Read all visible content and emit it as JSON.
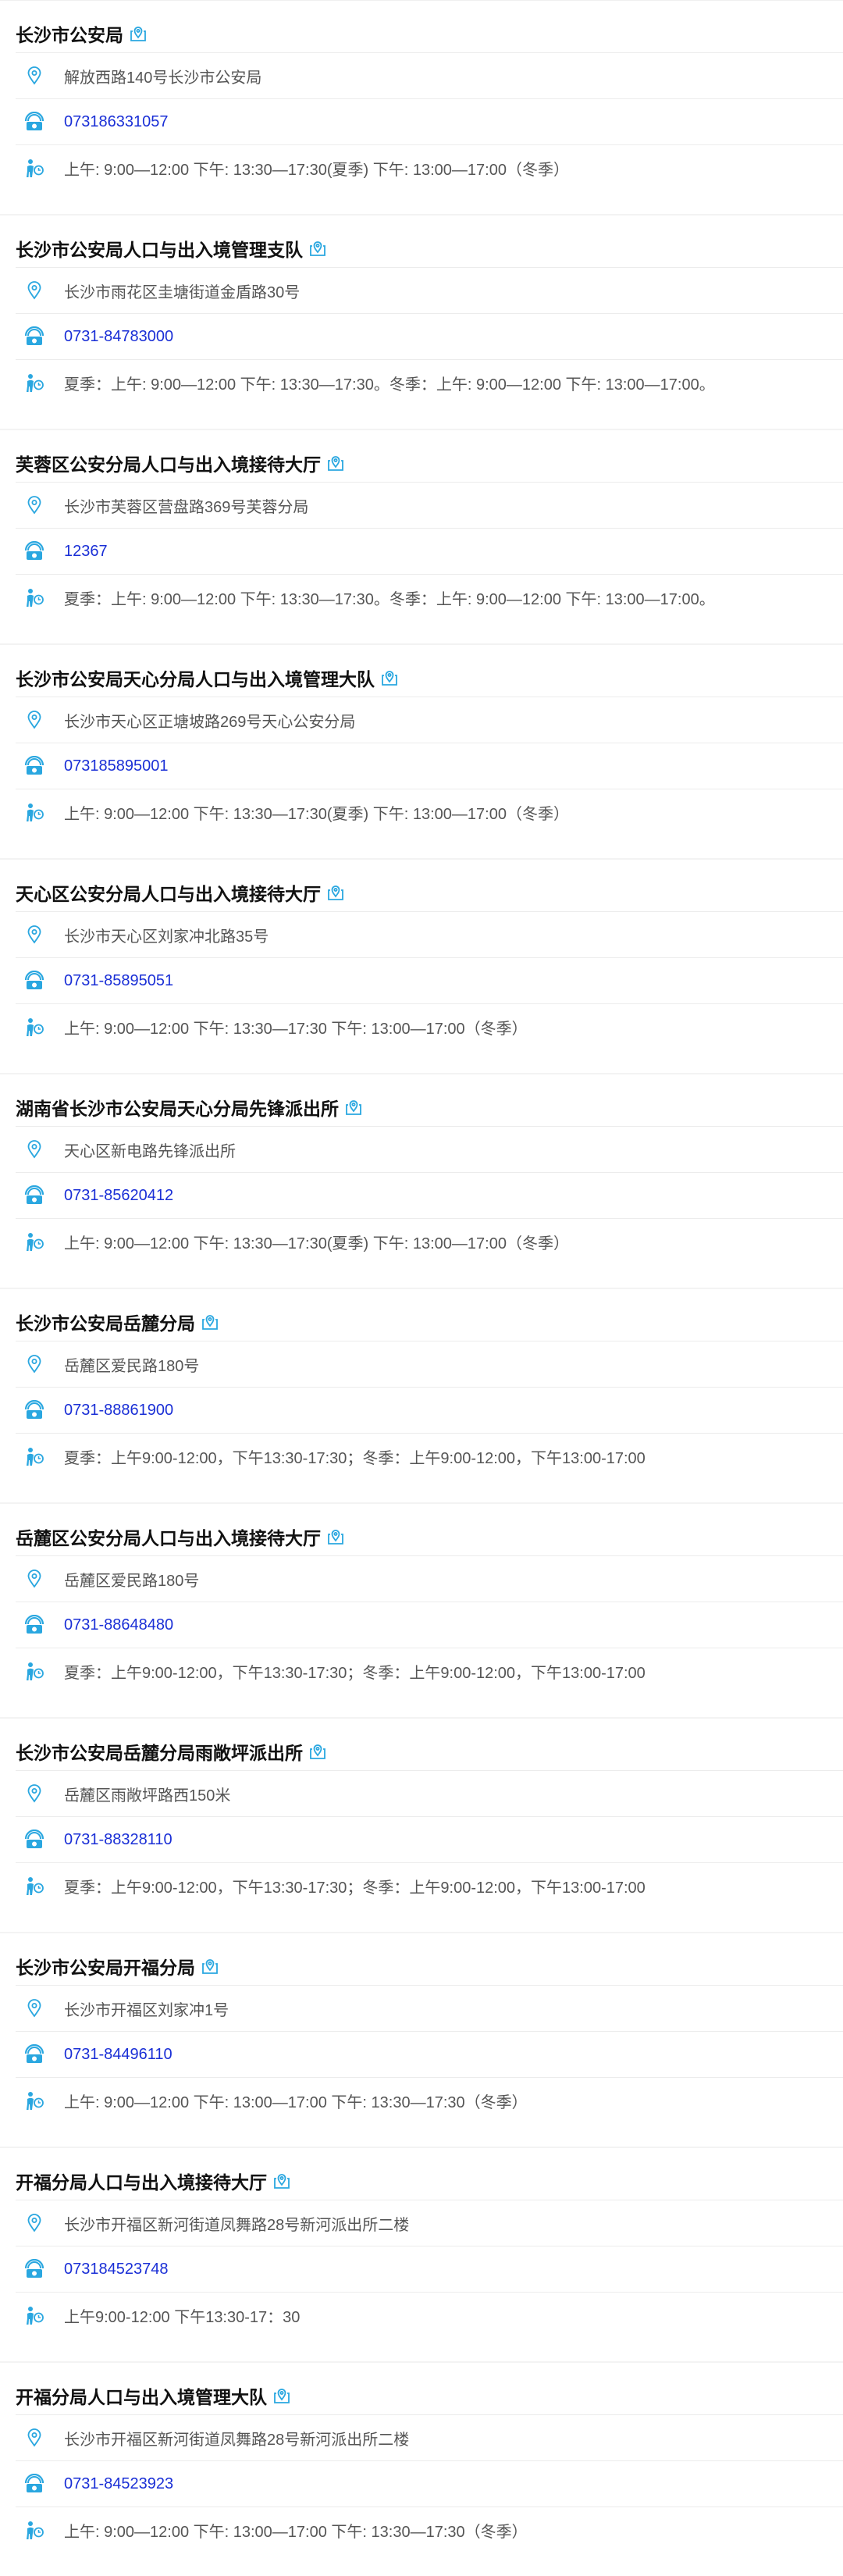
{
  "offices": [
    {
      "name": "长沙市公安局",
      "address": "解放西路140号长沙市公安局",
      "phone": "073186331057",
      "hours": "上午: 9:00—12:00 下午: 13:30—17:30(夏季) 下午: 13:00—17:00（冬季）"
    },
    {
      "name": "长沙市公安局人口与出入境管理支队",
      "address": "长沙市雨花区圭塘街道金盾路30号",
      "phone": "0731-84783000",
      "hours": "夏季：上午: 9:00—12:00 下午: 13:30—17:30。冬季：上午: 9:00—12:00 下午: 13:00—17:00。"
    },
    {
      "name": "芙蓉区公安分局人口与出入境接待大厅",
      "address": "长沙市芙蓉区营盘路369号芙蓉分局",
      "phone": "12367",
      "hours": "夏季：上午: 9:00—12:00 下午: 13:30—17:30。冬季：上午: 9:00—12:00 下午: 13:00—17:00。"
    },
    {
      "name": "长沙市公安局天心分局人口与出入境管理大队",
      "address": "长沙市天心区正塘坡路269号天心公安分局",
      "phone": "073185895001",
      "hours": "上午: 9:00—12:00 下午: 13:30—17:30(夏季) 下午: 13:00—17:00（冬季）"
    },
    {
      "name": "天心区公安分局人口与出入境接待大厅",
      "address": "长沙市天心区刘家冲北路35号",
      "phone": "0731-85895051",
      "hours": "上午: 9:00—12:00 下午: 13:30—17:30 下午: 13:00—17:00（冬季）"
    },
    {
      "name": "湖南省长沙市公安局天心分局先锋派出所",
      "address": "天心区新电路先锋派出所",
      "phone": "0731-85620412",
      "hours": "上午: 9:00—12:00 下午: 13:30—17:30(夏季)   下午: 13:00—17:00（冬季）"
    },
    {
      "name": "长沙市公安局岳麓分局",
      "address": "岳麓区爱民路180号",
      "phone": "0731-88861900",
      "hours": "夏季：上午9:00-12:00，下午13:30-17:30；冬季：上午9:00-12:00，下午13:00-17:00"
    },
    {
      "name": "岳麓区公安分局人口与出入境接待大厅",
      "address": "岳麓区爱民路180号",
      "phone": "0731-88648480",
      "hours": "夏季：上午9:00-12:00，下午13:30-17:30；冬季：上午9:00-12:00，下午13:00-17:00"
    },
    {
      "name": "长沙市公安局岳麓分局雨敞坪派出所",
      "address": "岳麓区雨敞坪路西150米",
      "phone": "0731-88328110",
      "hours": "夏季：上午9:00-12:00，下午13:30-17:30；冬季：上午9:00-12:00，下午13:00-17:00"
    },
    {
      "name": "长沙市公安局开福分局",
      "address": "长沙市开福区刘家冲1号",
      "phone": "0731-84496110",
      "hours": "上午: 9:00—12:00 下午: 13:00—17:00 下午: 13:30—17:30（冬季）"
    },
    {
      "name": "开福分局人口与出入境接待大厅",
      "address": "长沙市开福区新河街道凤舞路28号新河派出所二楼",
      "phone": "073184523748",
      "hours": "上午9:00-12:00 下午13:30-17：30"
    },
    {
      "name": "开福分局人口与出入境管理大队",
      "address": "长沙市开福区新河街道凤舞路28号新河派出所二楼",
      "phone": "0731-84523923",
      "hours": "上午: 9:00—12:00 下午: 13:00—17:00 下午: 13:30—17:30（冬季）"
    }
  ],
  "icons": {
    "map": "map-marker-icon",
    "location": "location-pin-icon",
    "phone": "phone-icon",
    "hours": "person-clock-icon"
  },
  "colors": {
    "accent": "#2aa7e0",
    "phone_text": "#1a2fd6",
    "address_text": "#555555"
  }
}
